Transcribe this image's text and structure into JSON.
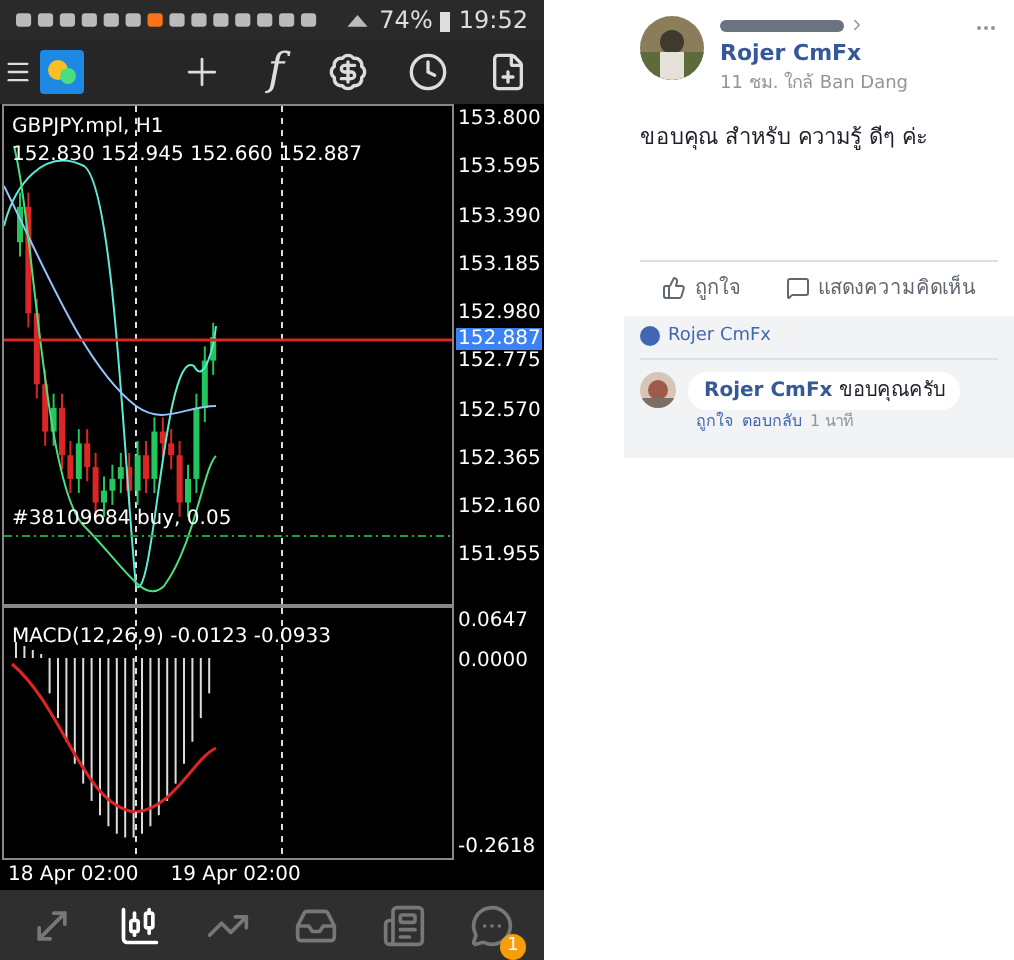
{
  "status_bar": {
    "battery": "74%",
    "time": "19:52"
  },
  "toolbar": {
    "function_glyph": "f"
  },
  "chart": {
    "symbol": "GBPJPY.mpl, H1",
    "ohlc": "152.830 152.945 152.660 152.887",
    "price_ticks": [
      "153.800",
      "153.595",
      "153.390",
      "153.185",
      "152.980",
      "152.775",
      "152.570",
      "152.365",
      "152.160",
      "151.955"
    ],
    "current_price": "152.887",
    "order_label": "#38109684 buy, 0.05",
    "macd": {
      "title": "MACD(12,26,9) -0.0123 -0.0933",
      "ticks": [
        "0.0647",
        "0.0000",
        "-0.2618"
      ]
    },
    "time_labels": [
      "18 Apr 02:00",
      "19 Apr 02:00"
    ]
  },
  "bottom_nav": [
    {
      "kind": "quotes",
      "selected": false
    },
    {
      "kind": "chart",
      "selected": true
    },
    {
      "kind": "trade",
      "selected": false
    },
    {
      "kind": "history",
      "selected": false
    },
    {
      "kind": "news",
      "selected": false
    },
    {
      "kind": "chat",
      "selected": false,
      "badge": "1"
    }
  ],
  "post": {
    "target": "Rojer CmFx",
    "meta": "11 ชม. ใกล้ Ban Dang",
    "text": "ขอบคุณ สำหรับ ความรู้ ดีๆ ค่ะ",
    "actions": [
      "ถูกใจ",
      "แสดงความคิดเห็น"
    ],
    "liked_by": "Rojer CmFx",
    "reply": {
      "author": "Rojer CmFx",
      "text": "ขอบคุณครับ",
      "actions": [
        "ถูกใจ",
        "ตอบกลับ",
        "1 นาที"
      ]
    }
  }
}
